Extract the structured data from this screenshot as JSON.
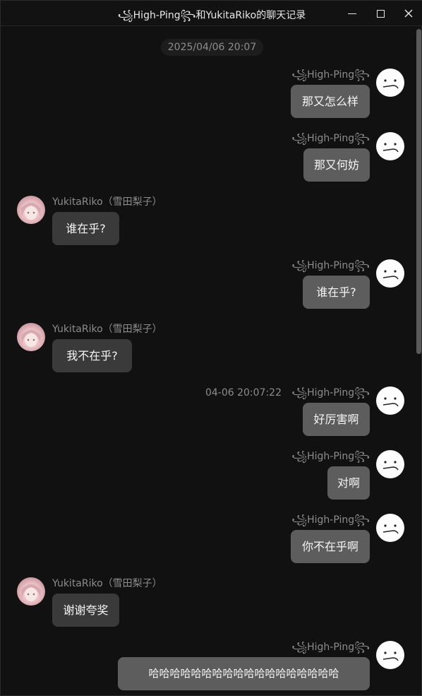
{
  "window": {
    "title": "꧁High-Ping꧂和YukitaRiko的聊天记录"
  },
  "timestamp_divider": "2025/04/06 20:07",
  "participants": {
    "me": {
      "name": "꧁High-Ping꧂",
      "avatar_icon": "meh-face-avatar"
    },
    "other": {
      "name": "YukitaRiko（雪田梨子）",
      "avatar_icon": "anime-girl-avatar"
    }
  },
  "messages": [
    {
      "sender": "me",
      "name": "꧁High-Ping꧂",
      "text": "那又怎么样"
    },
    {
      "sender": "me",
      "name": "꧁High-Ping꧂",
      "text": "那又何妨"
    },
    {
      "sender": "other",
      "name": "YukitaRiko（雪田梨子）",
      "text": "谁在乎?"
    },
    {
      "sender": "me",
      "name": "꧁High-Ping꧂",
      "text": "谁在乎?"
    },
    {
      "sender": "other",
      "name": "YukitaRiko（雪田梨子）",
      "text": "我不在乎?"
    },
    {
      "sender": "me",
      "name": "꧁High-Ping꧂",
      "time": "04-06 20:07:22",
      "text": "好厉害啊"
    },
    {
      "sender": "me",
      "name": "꧁High-Ping꧂",
      "text": "对啊"
    },
    {
      "sender": "me",
      "name": "꧁High-Ping꧂",
      "text": "你不在乎啊"
    },
    {
      "sender": "other",
      "name": "YukitaRiko（雪田梨子）",
      "text": "谢谢夸奖"
    },
    {
      "sender": "me",
      "name": "꧁High-Ping꧂",
      "text": "哈哈哈哈哈哈哈哈哈哈哈哈哈哈哈哈哈哈"
    }
  ],
  "colors": {
    "background": "#111111",
    "bubble_me": "#5d5d5d",
    "bubble_other": "#3a3a3a",
    "name_text": "#8c8c8c"
  }
}
